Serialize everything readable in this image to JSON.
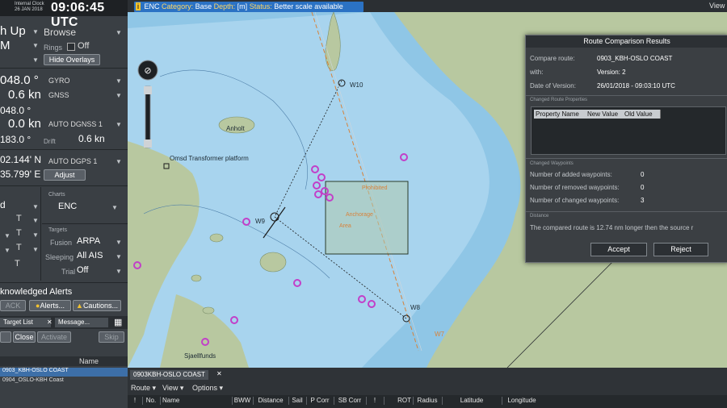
{
  "clock": {
    "label": "Internal Clock",
    "date": "26 JAN 2018",
    "time": "09:06:45 UTC"
  },
  "left": {
    "orientation": "h Up",
    "mode": "Browse",
    "motion": "M",
    "rings_label": "Rings",
    "rings_value": "Off",
    "hide_overlays": "Hide Overlays",
    "heading": "048.0 °",
    "heading_src": "GYRO",
    "speed": "0.6 kn",
    "speed_src": "GNSS",
    "cog": "048.0 °",
    "sog": "0.0 kn",
    "sog_src": "AUTO DGNSS 1",
    "set": "183.0 °",
    "drift_label": "Drift",
    "drift": "0.6 kn",
    "lat": "02.144' N",
    "lat_src": "AUTO DGPS 1",
    "lon": "35.799' E",
    "adjust": "Adjust",
    "d_label": "d",
    "charts_label": "Charts",
    "charts_value": "ENC",
    "targets_label": "Targets",
    "fusion_label": "Fusion",
    "fusion_value": "ARPA",
    "sleeping_label": "Sleeping",
    "sleeping_value": "All AIS",
    "trial_label": "Trial",
    "trial_value": "Off",
    "t_marks": [
      "T",
      "T",
      "T",
      "T"
    ],
    "alerts_header": "knowledged Alerts",
    "ack": "ACK",
    "alerts_btn": "Alerts...",
    "cautions_btn": "Cautions...",
    "tab_target": "Target List",
    "tab_message": "Message...",
    "clear": "Clear",
    "close": "Close",
    "activate": "Activate",
    "skip": "Skip",
    "name_col": "Name",
    "routes": [
      "0903_KBH-OSLO COAST",
      "0904_OSLO-KBH Coast"
    ]
  },
  "enc_bar": {
    "enc": "ENC",
    "cat_label": "Category:",
    "cat_value": "Base",
    "depth_label": "Depth:",
    "depth_value": "[m]",
    "status_label": "Status:",
    "status_value": "Better scale available"
  },
  "top_right": "View",
  "map": {
    "labels": {
      "anholt": "Anholt",
      "platform": "Omsd Transformer platform",
      "spjalfunds": "Sjaellfunds"
    },
    "waypoints": {
      "w9": "W9",
      "w10": "W10",
      "w8": "W8",
      "w7": "W7"
    },
    "box_texts": [
      "Prohibited",
      "Anchorage",
      "Area"
    ]
  },
  "dialog": {
    "title": "Route Comparison Results",
    "compare_label": "Compare route:",
    "compare_value": "0903_KBH-OSLO COAST",
    "with_label": "with:",
    "with_value": "Version: 2",
    "date_label": "Date of Version:",
    "date_value": "26/01/2018 - 09:03:10 UTC",
    "sec_props": "Changed Route Properties",
    "col_property": "Property Name",
    "col_new": "New Value",
    "col_old": "Old Value",
    "sec_waypoints": "Changed Waypoints",
    "added_label": "Number of added waypoints:",
    "added_value": "0",
    "removed_label": "Number of removed waypoints:",
    "removed_value": "0",
    "changed_label": "Number of changed waypoints:",
    "changed_value": "3",
    "sec_distance": "Distance",
    "distance_text": "The compared route is 12.74 nm longer then the source r",
    "accept": "Accept",
    "reject": "Reject"
  },
  "bottom": {
    "tab": "0903KBH-OSLO COAST",
    "menu": [
      "Route",
      "View",
      "Options"
    ],
    "columns": [
      "!",
      "No.",
      "Name",
      "BWW",
      "Distance",
      "Sail",
      "P Corr",
      "SB Corr",
      "!",
      "ROT",
      "Radius",
      "Latitude",
      "Longitude"
    ]
  },
  "colors": {
    "deep_water": "#8fc6e6",
    "shallow_water": "#a8d4ee",
    "land": "#b8c8a0",
    "accent_blue": "#2b72c4",
    "magenta_buoy": "#c23fc8"
  }
}
